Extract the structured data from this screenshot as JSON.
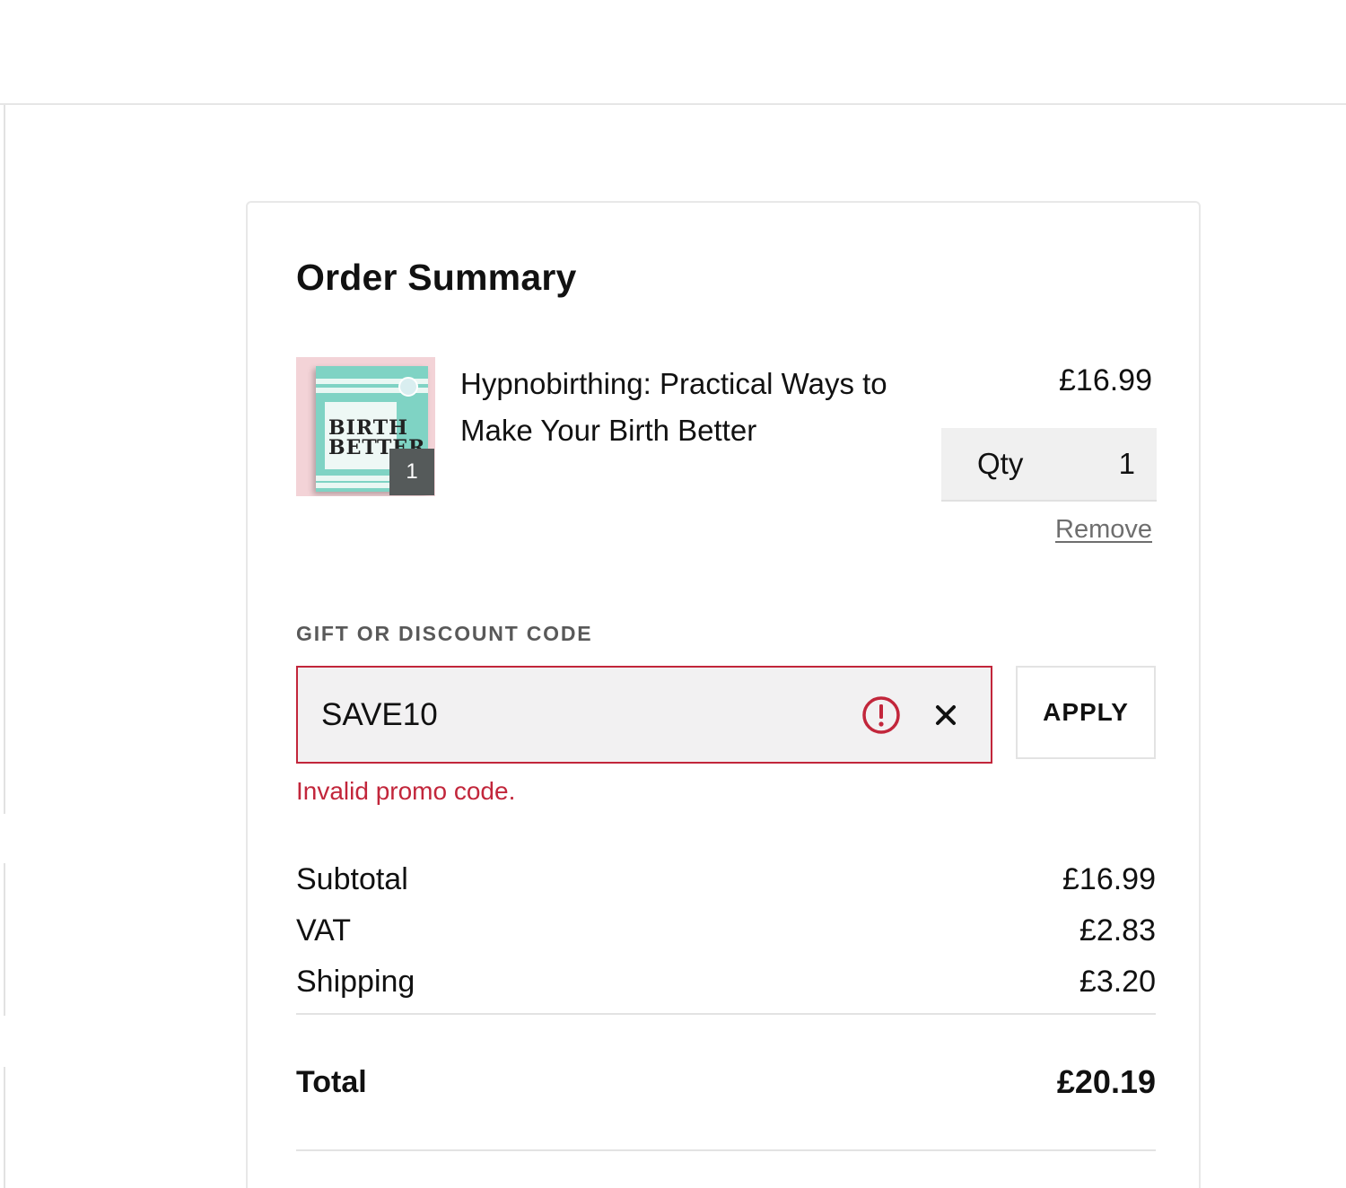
{
  "order_summary": {
    "title": "Order Summary",
    "item": {
      "title": "Hypnobirthing: Practical Ways to Make Your Birth Better",
      "price": "£16.99",
      "thumbnail_badge": "1",
      "cover_text": "BIRTH BETTER",
      "qty_label": "Qty",
      "qty_value": "1",
      "remove_label": "Remove"
    },
    "discount": {
      "label": "GIFT OR DISCOUNT CODE",
      "value": "SAVE10",
      "apply_label": "APPLY",
      "error": "Invalid promo code.",
      "error_color": "#c2263b"
    },
    "totals": {
      "subtotal_label": "Subtotal",
      "subtotal_value": "£16.99",
      "vat_label": "VAT",
      "vat_value": "£2.83",
      "shipping_label": "Shipping",
      "shipping_value": "£3.20",
      "total_label": "Total",
      "total_value": "£20.19"
    }
  },
  "icons": {
    "warning": "exclamation-circle-icon",
    "clear": "close-icon"
  }
}
